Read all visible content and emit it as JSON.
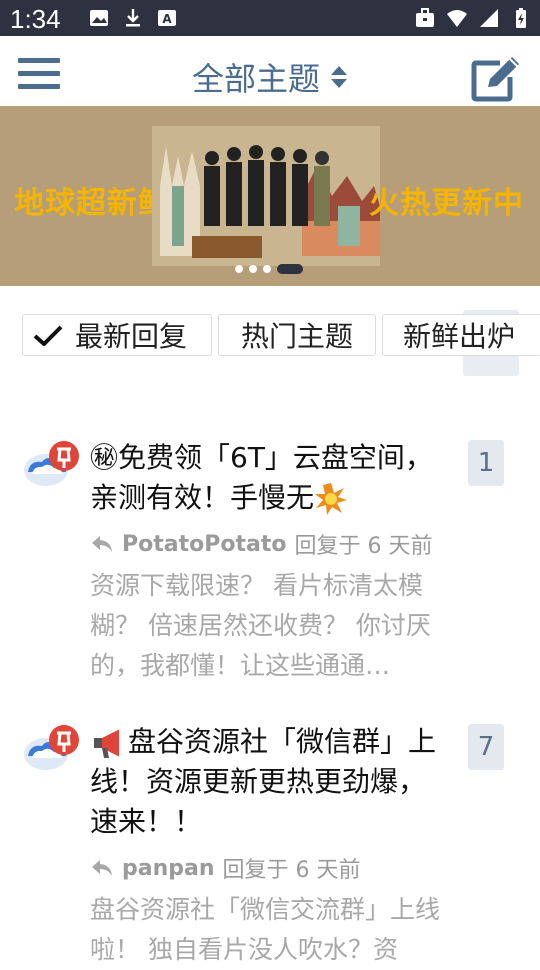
{
  "status_bar": {
    "time": "1:34"
  },
  "app_bar": {
    "title": "全部主题"
  },
  "banner": {
    "left_text": "地球超新鲜",
    "right_text": "火热更新中",
    "dot_count": 4,
    "active_dot": 3
  },
  "tabs": [
    {
      "label": "最新回复",
      "selected": true
    },
    {
      "label": "热门主题",
      "selected": false
    },
    {
      "label": "新鲜出炉",
      "selected": false
    }
  ],
  "posts": [
    {
      "title_prefix": "㊙",
      "title": "免费领「6T」云盘空间，亲测有效！手慢无",
      "author": "PotatoPotato",
      "reply_text": "回复于 6 天前",
      "excerpt": "资源下载限速？ 看片标清太模糊？ 倍速居然还收费？ 你讨厌的，我都懂！让这些通通…",
      "reply_count": "1"
    },
    {
      "title": "盘谷资源社「微信群」上线！资源更新更热更劲爆，速来！！",
      "author": "panpan",
      "reply_text": "回复于 6 天前",
      "excerpt": "盘谷资源社「微信交流群」上线啦！ 独自看片没人吹水？资",
      "reply_count": "7"
    }
  ],
  "colors": {
    "accent": "#4a6d8f",
    "status_bar": "#2d3140",
    "banner_bg": "#b59e78",
    "banner_text": "#f5b400"
  }
}
